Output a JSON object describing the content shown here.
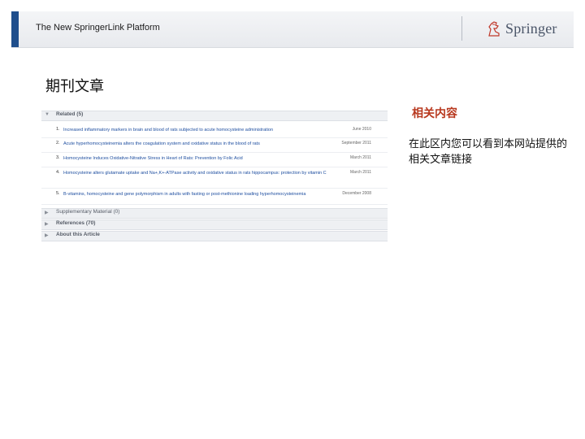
{
  "header": {
    "platform_title": "The New SpringerLink Platform",
    "logo_text": "Springer",
    "accent_color": "#1f4e8c"
  },
  "page": {
    "heading": "期刊文章"
  },
  "panel": {
    "related": {
      "label": "Related (5)",
      "items": [
        {
          "num": "1.",
          "title": "Increased inflammatory markers in brain and blood of rats subjected to acute homocysteine administration",
          "date": "June 2010"
        },
        {
          "num": "2.",
          "title": "Acute hyperhomocysteinemia alters the coagulation system and oxidative status in the blood of rats",
          "date": "September 2011"
        },
        {
          "num": "3.",
          "title": "Homocysteine Induces Oxidative-Nitrative Stress in Heart of Rats: Prevention by Folic Acid",
          "date": "March 2011"
        },
        {
          "num": "4.",
          "title": "Homocysteine alters glutamate uptake and Na+,K+-ATPase activity and oxidative status in rats hippocampus: protection by vitamin C",
          "date": "March 2011"
        },
        {
          "num": "5.",
          "title": "B-vitamins, homocysteine and gene polymorphism in adults with fasting or post-methionine loading hyperhomocysteinemia",
          "date": "December 2008"
        }
      ]
    },
    "supplementary": {
      "label": "Supplementary Material (0)"
    },
    "references": {
      "label": "References (70)"
    },
    "about": {
      "label": "About this Article"
    }
  },
  "sidebar": {
    "title": "相关内容",
    "description": "在此区内您可以看到本网站提供的相关文章链接"
  }
}
